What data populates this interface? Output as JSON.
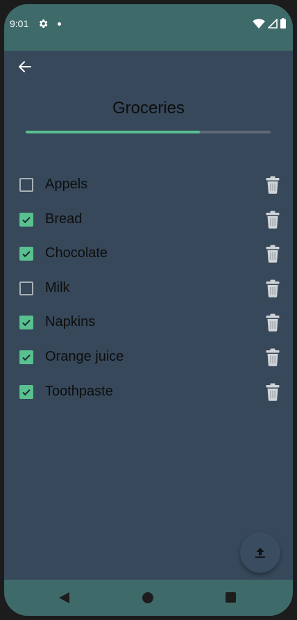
{
  "status_bar": {
    "time": "9:01",
    "icons": [
      "gear-icon",
      "notification-dot-icon",
      "wifi-icon",
      "signal-icon",
      "battery-icon"
    ]
  },
  "header": {
    "back_icon": "arrow-left-icon",
    "title": "Groceries"
  },
  "progress": {
    "fraction": 0.71
  },
  "items": [
    {
      "label": "Appels",
      "checked": false
    },
    {
      "label": "Bread",
      "checked": true
    },
    {
      "label": "Chocolate",
      "checked": true
    },
    {
      "label": "Milk",
      "checked": false
    },
    {
      "label": "Napkins",
      "checked": true
    },
    {
      "label": "Orange juice",
      "checked": true
    },
    {
      "label": "Toothpaste",
      "checked": true
    }
  ],
  "fab": {
    "icon": "upload-icon"
  },
  "nav_bar": {
    "icons": [
      "nav-back-icon",
      "nav-home-icon",
      "nav-recents-icon"
    ]
  },
  "colors": {
    "accent": "#59c08f",
    "background": "#36485a",
    "bars": "#3f6a6a"
  }
}
